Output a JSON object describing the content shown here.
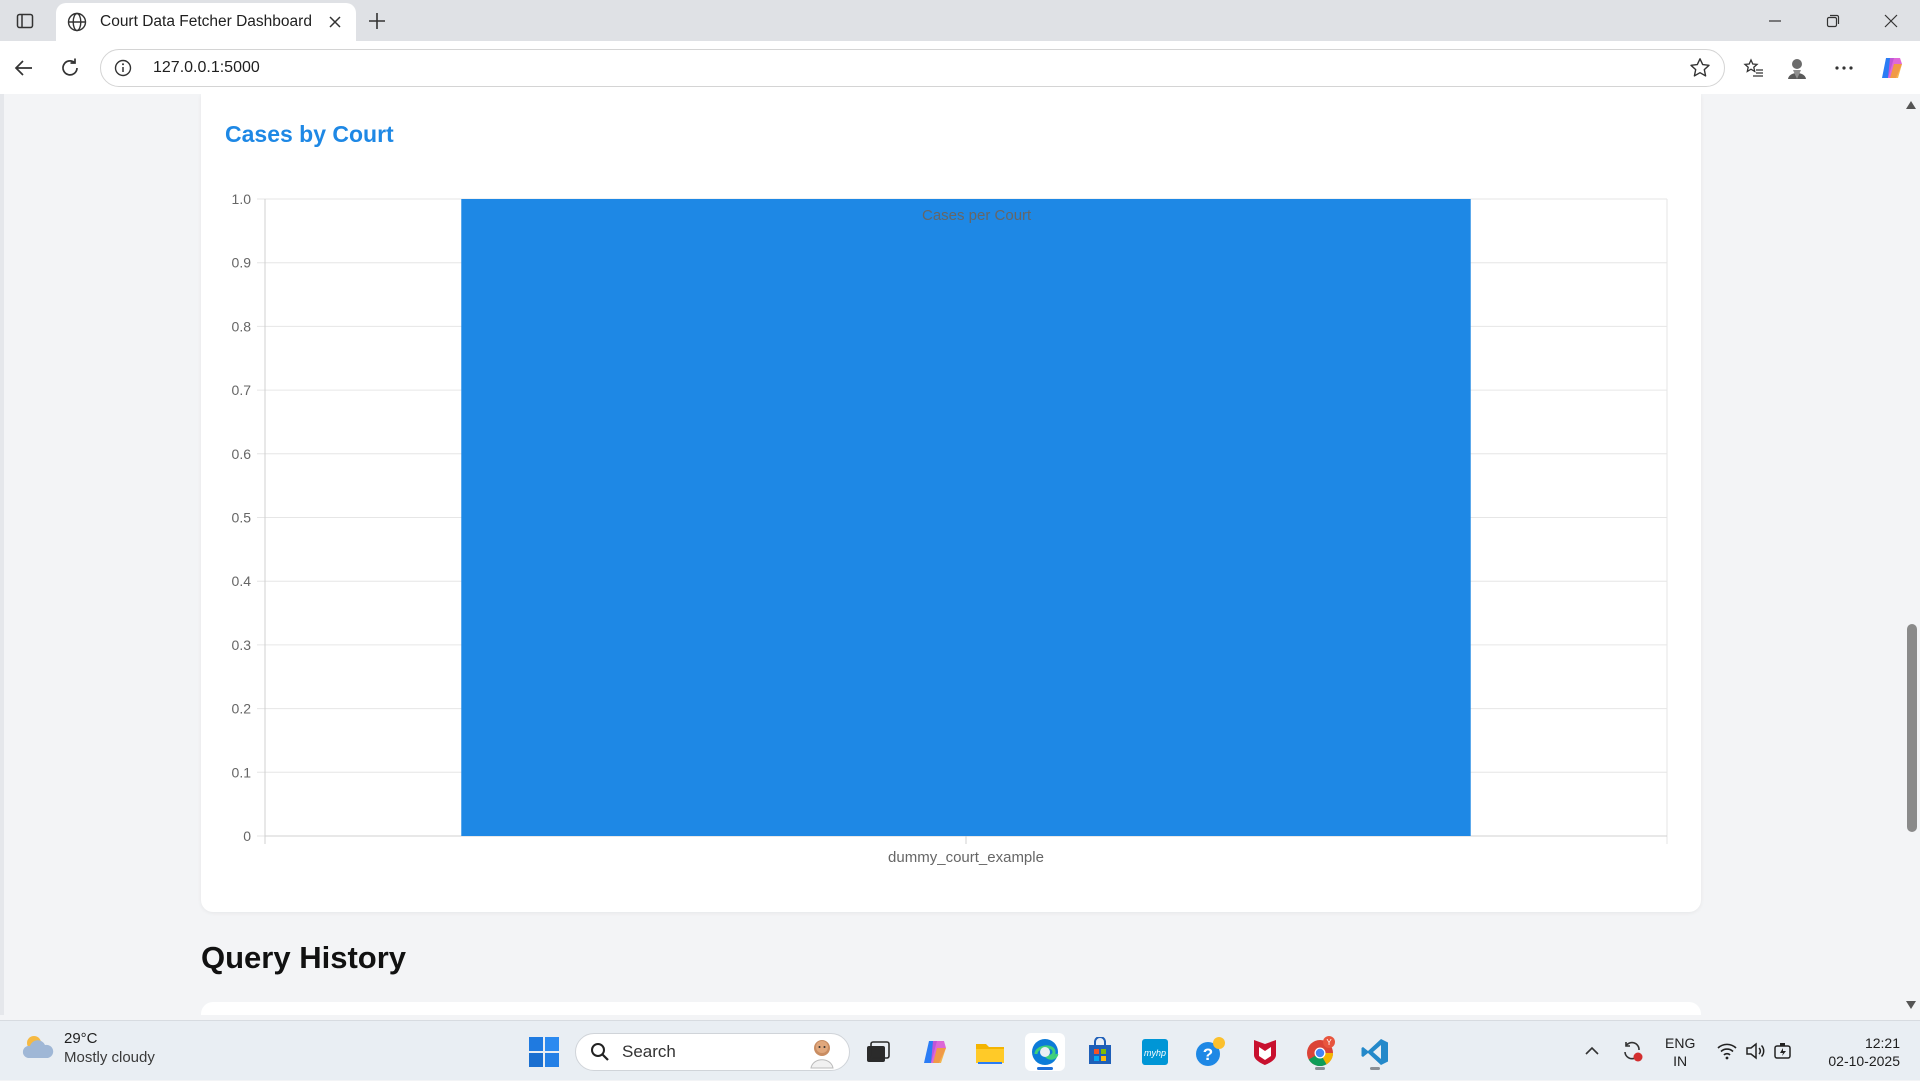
{
  "browser": {
    "tab_title": "Court Data Fetcher Dashboard",
    "url": "127.0.0.1:5000"
  },
  "page": {
    "card_title": "Cases by Court",
    "query_history_title": "Query History"
  },
  "chart_data": {
    "type": "bar",
    "categories": [
      "dummy_court_example"
    ],
    "series": [
      {
        "name": "Cases per Court",
        "values": [
          1
        ],
        "color": "#1e88e5"
      }
    ],
    "ylim": [
      0,
      1
    ],
    "yticks": [
      "0",
      "0.1",
      "0.2",
      "0.3",
      "0.4",
      "0.5",
      "0.6",
      "0.7",
      "0.8",
      "0.9",
      "1.0"
    ],
    "legend": "top-center",
    "grid": true
  },
  "taskbar": {
    "temperature": "29°C",
    "weather": "Mostly cloudy",
    "search_label": "Search",
    "lang_line1": "ENG",
    "lang_line2": "IN",
    "time": "12:21",
    "date": "02-10-2025",
    "chrome_badge": "Y"
  }
}
